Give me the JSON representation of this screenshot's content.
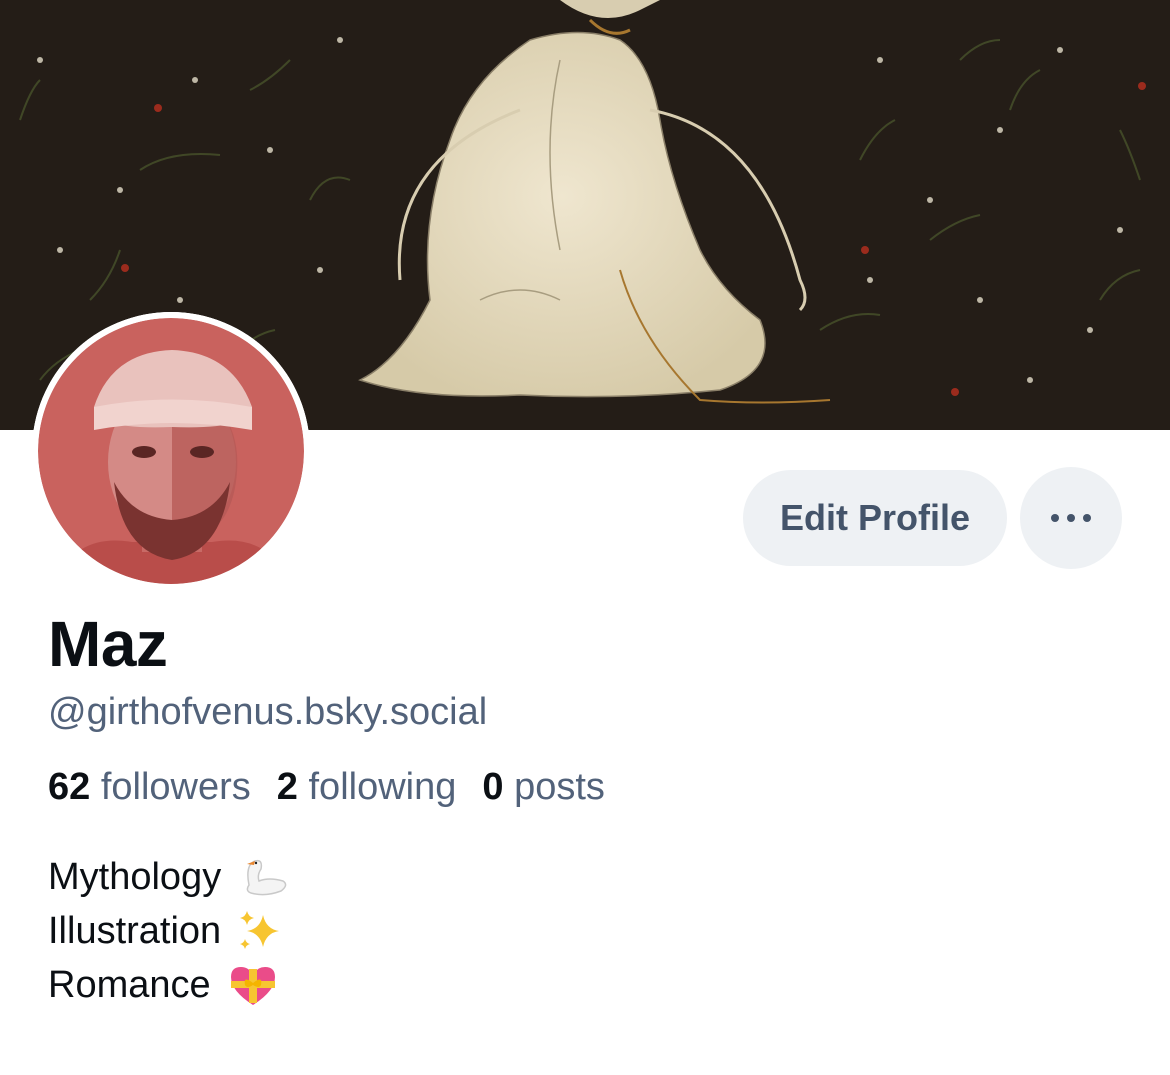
{
  "profile": {
    "display_name": "Maz",
    "handle": "@girthofvenus.bsky.social",
    "edit_label": "Edit Profile",
    "more_label": "More options"
  },
  "stats": [
    {
      "count": "62",
      "label": "followers"
    },
    {
      "count": "2",
      "label": "following"
    },
    {
      "count": "0",
      "label": "posts"
    }
  ],
  "bio": [
    {
      "text": "Mythology",
      "emoji": "swan-emoji"
    },
    {
      "text": "Illustration",
      "emoji": "sparkles-emoji"
    },
    {
      "text": "Romance",
      "emoji": "heart-with-ribbon-emoji"
    }
  ],
  "colors": {
    "button_bg": "#eef1f4",
    "button_text": "#44546a",
    "secondary_text": "#52627a",
    "primary_text": "#0b0f14",
    "banner_bg": "#241d17",
    "avatar_tint": "#c9625e"
  }
}
